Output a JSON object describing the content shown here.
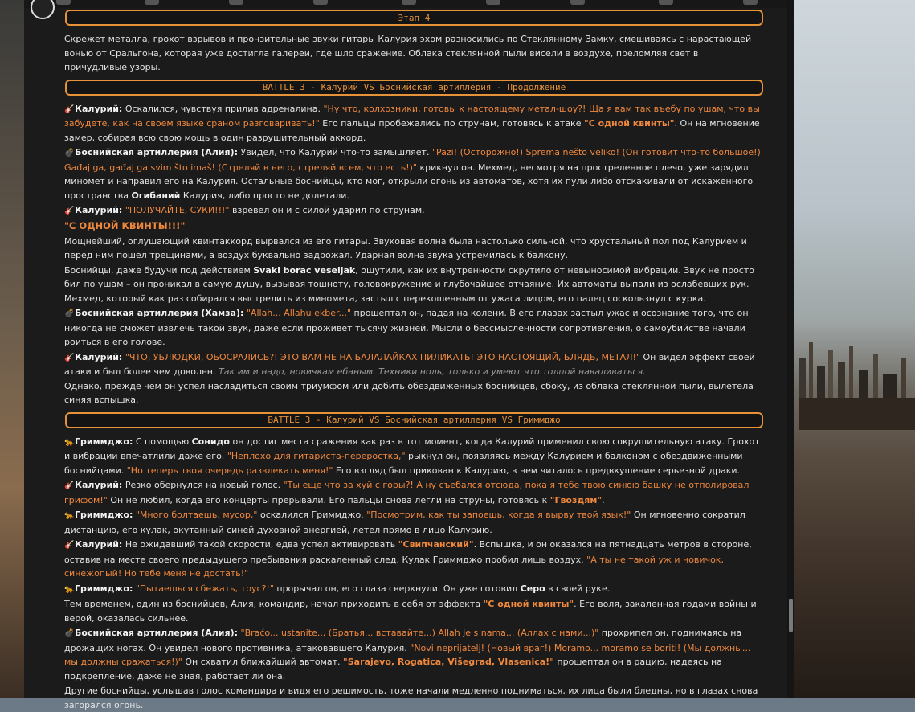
{
  "stage_banner": "Этап 4",
  "battle_banner_1": "BATTLE 3 - Калурий VS Боснийская артиллерия - Продолжение",
  "battle_banner_2": "BATTLE 3 - Калурий VS Боснийская артиллерия VS Гриммджо",
  "icons": {
    "kalurium": "guitar-icon",
    "artillery": "bomb-icon",
    "grimmjow": "panther-icon"
  },
  "para_intro": "Скрежет металла, грохот взрывов и пронзительные звуки гитары Калурия эхом разносились по Стеклянному Замку, смешиваясь с нарастающей вонью от Сральгона, которая уже достигла галереи, где шло сражение. Облака стеклянной пыли висели в воздухе, преломляя свет в причудливые узоры.",
  "m1": {
    "speaker": "Калурий:",
    "a": " Оскалился, чувствуя прилив адреналина. ",
    "q1": "\"Ну что, колхозники, готовы к настоящему метал-шоу?! Ща я вам так въебу по ушам, что вы забудете, как на своем языке сраном разговаривать!\"",
    "b": " Его пальцы пробежались по струнам, готовясь к атаке ",
    "q2": "\"С одной квинты\"",
    "c": ". Он на мгновение замер, собирая всю свою мощь в один разрушительный аккорд."
  },
  "m2": {
    "speaker": "Боснийская артиллерия (Алия):",
    "a": " Увидел, что Калурий что-то замышляет. ",
    "q1": "\"Pazi! (Осторожно!) Sprema nešto veliko! (Он готовит что-то большое!) Gađaj ga, gađaj ga svim što imaš! (Стреляй в него, стреляй всем, что есть!)\"",
    "b": " крикнул он. Мехмед, несмотря на простреленное плечо, уже зарядил миномет и направил его на Калурия. Остальные боснийцы, кто мог, открыли огонь из автоматов, хотя их пули либо отскакивали от искаженного пространства ",
    "bold": "Огибаний",
    "c": " Калурия, либо просто не долетали."
  },
  "m3": {
    "speaker": "Калурий:",
    "q1": " \"ПОЛУЧАЙТЕ, СУКИ!!!\"",
    "a": " взревел он и с силой ударил по струнам."
  },
  "big_shout": "\"С ОДНОЙ КВИНТЫ!!!\"",
  "para_wave": "Мощнейший, оглушающий квинтаккорд вырвался из его гитары. Звуковая волна была настолько сильной, что хрустальный пол под Калурием и перед ним пошел трещинами, а воздух буквально задрожал. Ударная волна звука устремилась к балкону.",
  "para_bos": {
    "a": "Боснийцы, даже будучи под действием ",
    "bold": "Svaki borac veseljak",
    "b": ", ощутили, как их внутренности скрутило от невыносимой вибрации. Звук не просто бил по ушам – он проникал в самую душу, вызывая тошноту, головокружение и глубочайшее отчаяние. Их автоматы выпали из ослабевших рук. Мехмед, который как раз собирался выстрелить из миномета, застыл с перекошенным от ужаса лицом, его палец соскользнул с курка."
  },
  "m4": {
    "speaker": "Боснийская артиллерия (Хамза):",
    "q1": " \"Allah... Allahu ekber...\"",
    "a": " прошептал он, падая на колени. В его глазах застыл ужас и осознание того, что он никогда не сможет извлечь такой звук, даже если проживет тысячу жизней. Мысли о бессмысленности сопротивления, о самоубийстве начали роиться в его голове."
  },
  "m5": {
    "speaker": "Калурий:",
    "q1": " \"ЧТО, УБЛЮДКИ, ОБОСРАЛИСЬ?! ЭТО ВАМ НЕ НА БАЛАЛАЙКАХ ПИЛИКАТЬ! ЭТО НАСТОЯЩИЙ, БЛЯДЬ, МЕТАЛ!\"",
    "a": " Он видел эффект своей атаки и был более чем доволен. ",
    "it": "Так им и надо, новичкам ебаным. Техники ноль, только и умеют что толпой наваливаться."
  },
  "para_flash": "Однако, прежде чем он успел насладиться своим триумфом или добить обездвиженных боснийцев, сбоку, из облака стеклянной пыли, вылетела синяя вспышка.",
  "g1": {
    "speaker": "Гриммджо:",
    "a": " С помощью ",
    "bold": "Сонидо",
    "b": " он достиг места сражения как раз в тот момент, когда Калурий применил свою сокрушительную атаку. Грохот и вибрации впечатлили даже его. ",
    "q1": "\"Неплохо для гитариста-переростка,\"",
    "c": " рыкнул он, появляясь между Калурием и балконом с обездвиженными боснийцами. ",
    "q2": "\"Но теперь твоя очередь развлекать меня!\"",
    "d": " Его взгляд был прикован к Калурию, в нем читалось предвкушение серьезной драки."
  },
  "k2": {
    "speaker": "Калурий:",
    "a": " Резко обернулся на новый голос. ",
    "q1": "\"Ты еще что за хуй с горы?! А ну съебался отсюда, пока я тебе твою синюю башку не отполировал грифом!\"",
    "b": " Он не любил, когда его концерты прерывали. Его пальцы снова легли на струны, готовясь к ",
    "q2": "\"Гвоздям\"",
    "c": "."
  },
  "g2": {
    "speaker": "Гриммджо:",
    "q1": " \"Много болтаешь, мусор,\"",
    "a": " оскалился Гриммджо. ",
    "q2": "\"Посмотрим, как ты запоешь, когда я вырву твой язык!\"",
    "b": " Он мгновенно сократил дистанцию, его кулак, окутанный синей духовной энергией, летел прямо в лицо Калурию."
  },
  "k3": {
    "speaker": "Калурий:",
    "a": " Не ожидавший такой скорости, едва успел активировать ",
    "q1": "\"Свипчанский\"",
    "b": ". Вспышка, и он оказался на пятнадцать метров в стороне, оставив на месте своего предыдущего пребывания раскаленный след. Кулак Гриммджо пробил лишь воздух. ",
    "q2": "\"А ты не такой уж и новичок, синежопый! Но тебе меня не достать!\""
  },
  "g3": {
    "speaker": "Гриммджо:",
    "q1": " \"Пытаешься сбежать, трус?!\"",
    "a": " прорычал он, его глаза сверкнули. Он уже готовил ",
    "bold": "Серо",
    "b": " в своей руке."
  },
  "para_aliya": {
    "a": "Тем временем, один из боснийцев, Алия, командир, начал приходить в себя от эффекта ",
    "q1": "\"С одной квинты\"",
    "b": ". Его воля, закаленная годами войны и верой, оказалась сильнее."
  },
  "m6": {
    "speaker": "Боснийская артиллерия (Алия):",
    "q1": " \"Braćo... ustanite... (Братья... вставайте...) Allah je s nama... (Аллах с нами...)\"",
    "a": " прохрипел он, поднимаясь на дрожащих ногах. Он увидел нового противника, атаковавшего Калурия. ",
    "q2": "\"Novi neprijatelj! (Новый враг!) Moramo... moramo se boriti! (Мы должны... мы должны сражаться!)\"",
    "b": " Он схватил ближайший автомат. ",
    "q3": "\"Sarajevo, Rogatica, Višegrad, Vlasenica!\"",
    "c": " прошептал он в рацию, надеясь на подкрепление, даже не зная, работает ли она."
  },
  "para_last": "Другие боснийцы, услышав голос командира и видя его решимость, тоже начали медленно подниматься, их лица были бледны, но в глазах снова загорался огонь."
}
